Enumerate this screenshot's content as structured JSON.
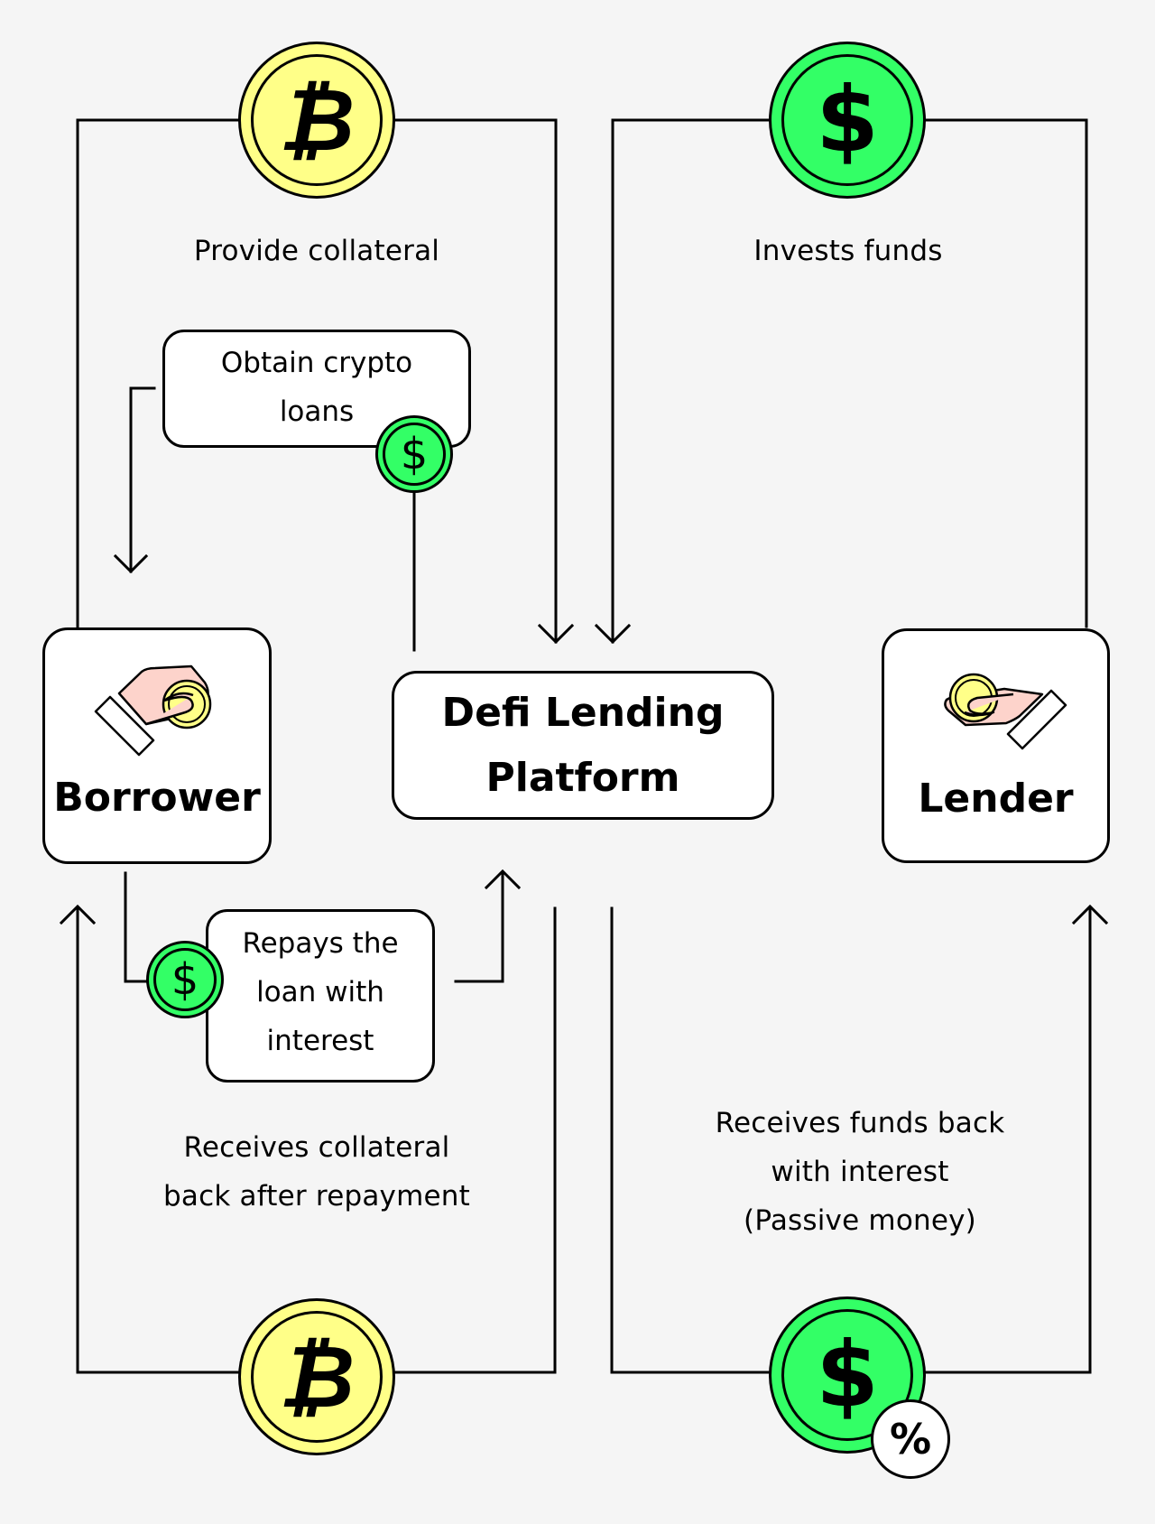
{
  "colors": {
    "background": "#f5f5f5",
    "bitcoin_coin": "#ffff88",
    "dollar_coin": "#33ff66",
    "hand_skin": "#fdd3cb",
    "stroke": "#000000"
  },
  "title": "Defi Lending Platform",
  "platform": {
    "title": "Defi Lending\nPlatform"
  },
  "actors": {
    "borrower": {
      "name": "Borrower",
      "icon": "hand-giving-coin-icon"
    },
    "lender": {
      "name": "Lender",
      "icon": "hand-giving-coin-icon"
    }
  },
  "flows": {
    "provide_collateral": {
      "label": "Provide collateral",
      "coin_icon": "bitcoin-coin-icon",
      "glyph": "₿"
    },
    "invests_funds": {
      "label": "Invests funds",
      "coin_icon": "dollar-coin-icon",
      "glyph": "$"
    },
    "obtain_loans": {
      "label": "Obtain crypto\nloans",
      "coin_icon": "dollar-coin-icon",
      "glyph": "$"
    },
    "repays_loan": {
      "label": "Repays the\nloan with\ninterest",
      "coin_icon": "dollar-coin-icon",
      "glyph": "$"
    },
    "receives_collateral": {
      "label": "Receives collateral\nback after repayment",
      "coin_icon": "bitcoin-coin-icon",
      "glyph": "₿"
    },
    "receives_funds": {
      "label": "Receives funds back\nwith interest\n(Passive money)",
      "coin_icon": "dollar-coin-icon",
      "glyph": "$",
      "badge_icon": "percent-icon",
      "badge_glyph": "%"
    }
  }
}
